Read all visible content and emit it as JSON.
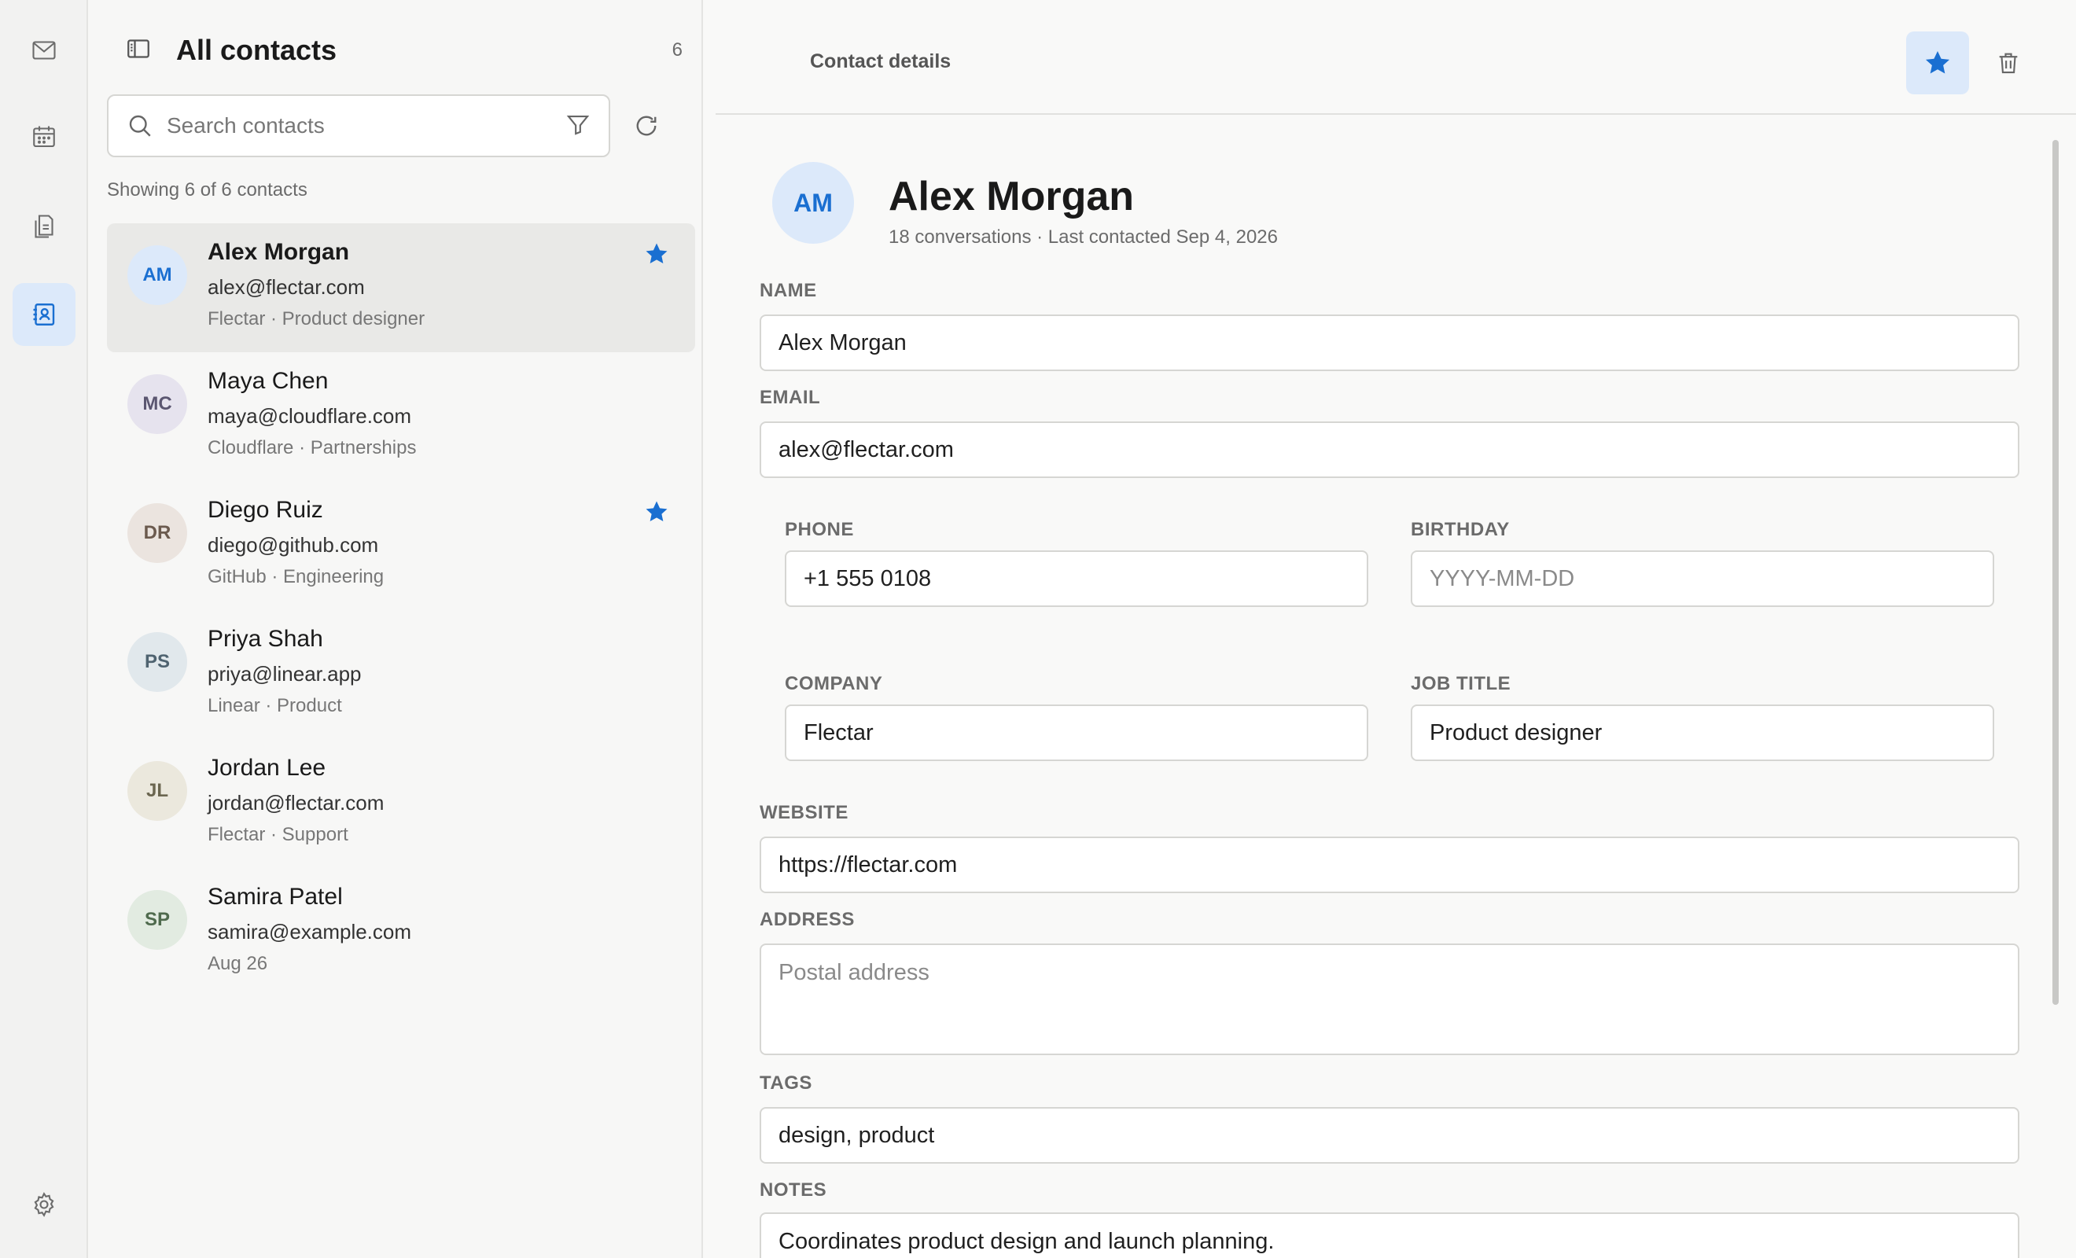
{
  "nav": {
    "items": [
      {
        "icon": "mail-icon"
      },
      {
        "icon": "calendar-icon"
      },
      {
        "icon": "documents-icon"
      },
      {
        "icon": "contacts-icon",
        "active": true
      }
    ],
    "settings_icon": "gear-icon"
  },
  "list": {
    "title": "All contacts",
    "count": "6",
    "search_placeholder": "Search contacts",
    "showing": "Showing 6 of 6 contacts",
    "contacts": [
      {
        "initials": "AM",
        "name": "Alex Morgan",
        "email": "alex@flectar.com",
        "meta": "Flectar · Product designer",
        "starred": true,
        "selected": true,
        "avatar_bg": "#dce9fa",
        "avatar_fg": "#1a6fd1"
      },
      {
        "initials": "MC",
        "name": "Maya Chen",
        "email": "maya@cloudflare.com",
        "meta": "Cloudflare · Partnerships",
        "starred": false,
        "selected": false,
        "avatar_bg": "#e6e3ee",
        "avatar_fg": "#5b5670"
      },
      {
        "initials": "DR",
        "name": "Diego Ruiz",
        "email": "diego@github.com",
        "meta": "GitHub · Engineering",
        "starred": true,
        "selected": false,
        "avatar_bg": "#ebe4df",
        "avatar_fg": "#6b5a4e"
      },
      {
        "initials": "PS",
        "name": "Priya Shah",
        "email": "priya@linear.app",
        "meta": "Linear · Product",
        "starred": false,
        "selected": false,
        "avatar_bg": "#e1e8ec",
        "avatar_fg": "#4f6370"
      },
      {
        "initials": "JL",
        "name": "Jordan Lee",
        "email": "jordan@flectar.com",
        "meta": "Flectar · Support",
        "starred": false,
        "selected": false,
        "avatar_bg": "#ebe8dd",
        "avatar_fg": "#6b6650"
      },
      {
        "initials": "SP",
        "name": "Samira Patel",
        "email": "samira@example.com",
        "meta": "Aug 26",
        "starred": false,
        "selected": false,
        "avatar_bg": "#e2ebe1",
        "avatar_fg": "#4f6a4d"
      }
    ]
  },
  "detail": {
    "title": "Contact details",
    "initials": "AM",
    "name": "Alex Morgan",
    "subtitle": "18 conversations · Last contacted Sep 4, 2026",
    "labels": {
      "name": "NAME",
      "email": "EMAIL",
      "phone": "PHONE",
      "birthday": "BIRTHDAY",
      "company": "COMPANY",
      "job_title": "JOB TITLE",
      "website": "WEBSITE",
      "address": "ADDRESS",
      "tags": "TAGS",
      "notes": "NOTES"
    },
    "values": {
      "name": "Alex Morgan",
      "email": "alex@flectar.com",
      "phone": "+1 555 0108",
      "birthday": "",
      "company": "Flectar",
      "job_title": "Product designer",
      "website": "https://flectar.com",
      "address": "",
      "tags": "design, product",
      "notes": "Coordinates product design and launch planning."
    },
    "placeholders": {
      "birthday": "YYYY-MM-DD",
      "address": "Postal address"
    }
  },
  "colors": {
    "accent": "#1a6fd1",
    "accent_soft": "#dce9fa",
    "selected_row": "#e9e9e7"
  }
}
